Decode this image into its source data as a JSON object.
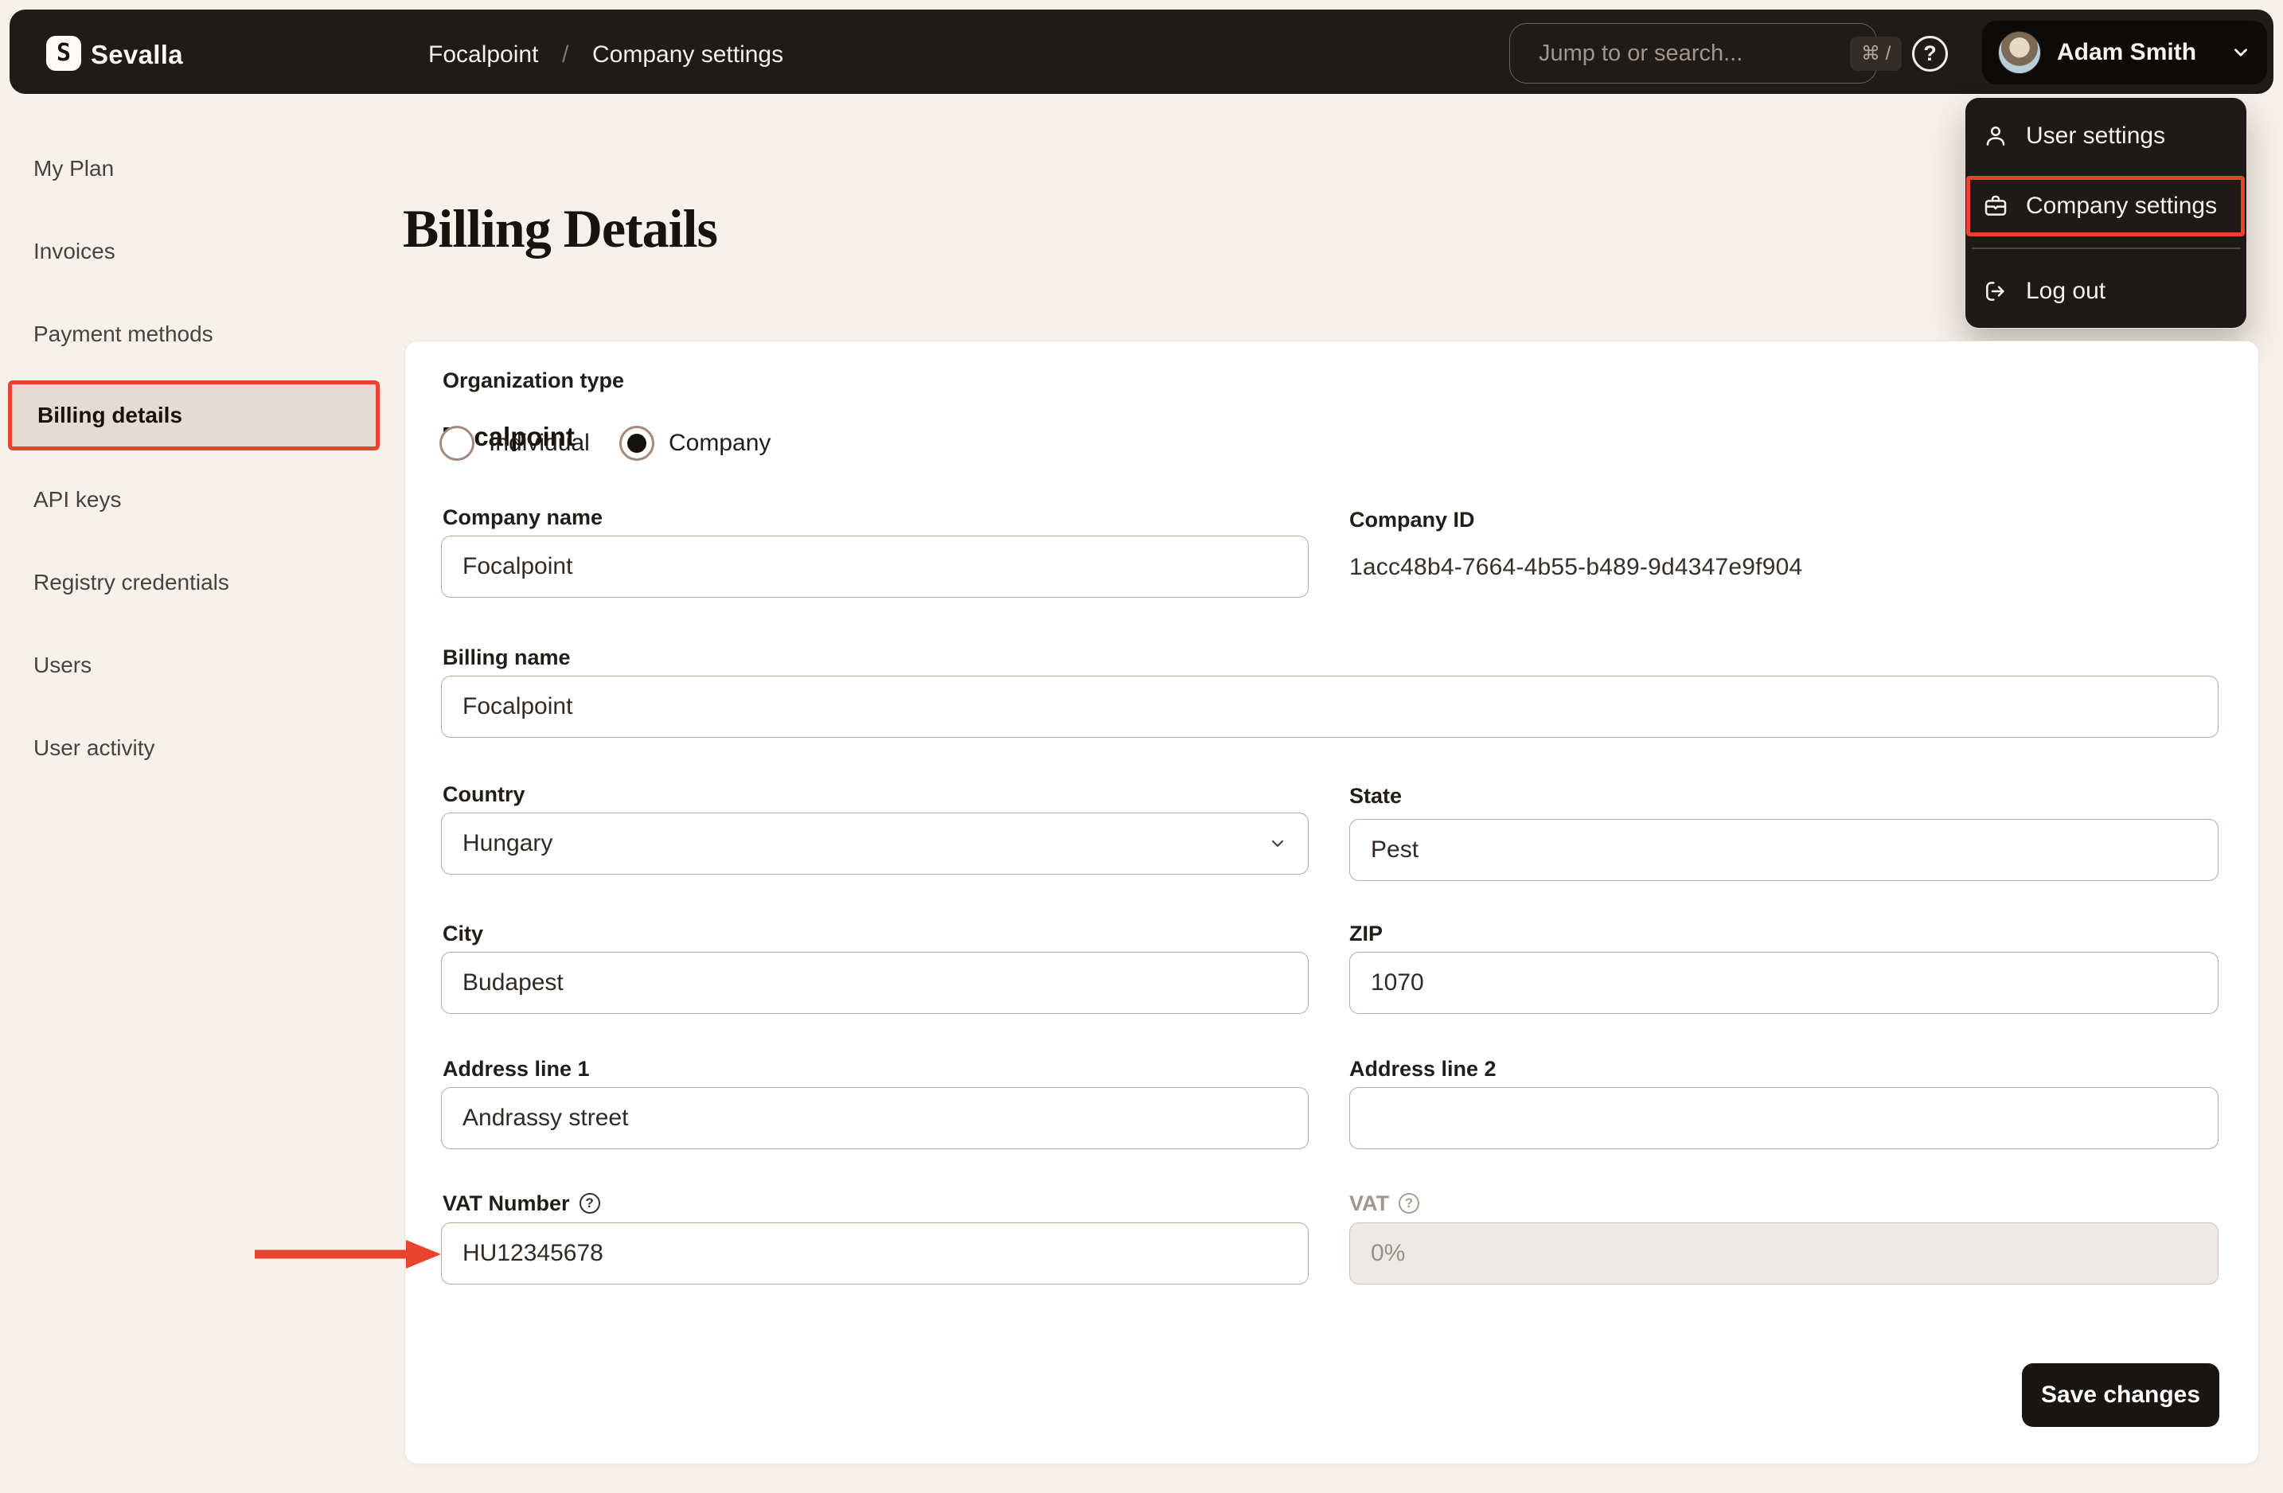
{
  "topbar": {
    "brand": "Sevalla",
    "logo_glyph": "S",
    "breadcrumb": {
      "org": "Focalpoint",
      "separator": "/",
      "page": "Company settings"
    },
    "search": {
      "placeholder": "Jump to or search...",
      "shortcut": "⌘ /"
    },
    "user": {
      "name": "Adam Smith"
    },
    "help_glyph": "?"
  },
  "user_menu": {
    "items": [
      {
        "label": "User settings",
        "icon": "user-icon"
      },
      {
        "label": "Company settings",
        "icon": "briefcase-icon",
        "annotated": true
      },
      {
        "label": "Log out",
        "icon": "logout-icon"
      }
    ]
  },
  "sidebar": {
    "items": [
      {
        "label": "My Plan"
      },
      {
        "label": "Invoices"
      },
      {
        "label": "Payment methods"
      },
      {
        "label": "Billing details",
        "active": true,
        "annotated": true
      },
      {
        "label": "API keys"
      },
      {
        "label": "Registry credentials"
      },
      {
        "label": "Users"
      },
      {
        "label": "User activity"
      }
    ]
  },
  "main": {
    "page_title": "Billing Details",
    "card": {
      "title": "Focalpoint",
      "organization_type": {
        "label": "Organization type",
        "options": [
          {
            "label": "Individual",
            "selected": false
          },
          {
            "label": "Company",
            "selected": true
          }
        ]
      },
      "fields": {
        "company_name": {
          "label": "Company name",
          "value": "Focalpoint"
        },
        "company_id": {
          "label": "Company ID",
          "value": "1acc48b4-7664-4b55-b489-9d4347e9f904"
        },
        "billing_name": {
          "label": "Billing name",
          "value": "Focalpoint"
        },
        "country": {
          "label": "Country",
          "value": "Hungary"
        },
        "state": {
          "label": "State",
          "value": "Pest"
        },
        "city": {
          "label": "City",
          "value": "Budapest"
        },
        "zip": {
          "label": "ZIP",
          "value": "1070"
        },
        "address1": {
          "label": "Address line 1",
          "value": "Andrassy street"
        },
        "address2": {
          "label": "Address line 2",
          "value": ""
        },
        "vat_number": {
          "label": "VAT Number",
          "value": "HU12345678"
        },
        "vat": {
          "label": "VAT",
          "value": "0%",
          "disabled": true
        }
      },
      "save_label": "Save changes"
    }
  },
  "colors": {
    "annotation_red": "#e8432c",
    "topbar_bg": "#1e1b18",
    "page_bg": "#f7f1ec",
    "active_item_bg": "#e6dbd2",
    "save_button_bg": "#181512",
    "input_border": "#baa99d"
  }
}
